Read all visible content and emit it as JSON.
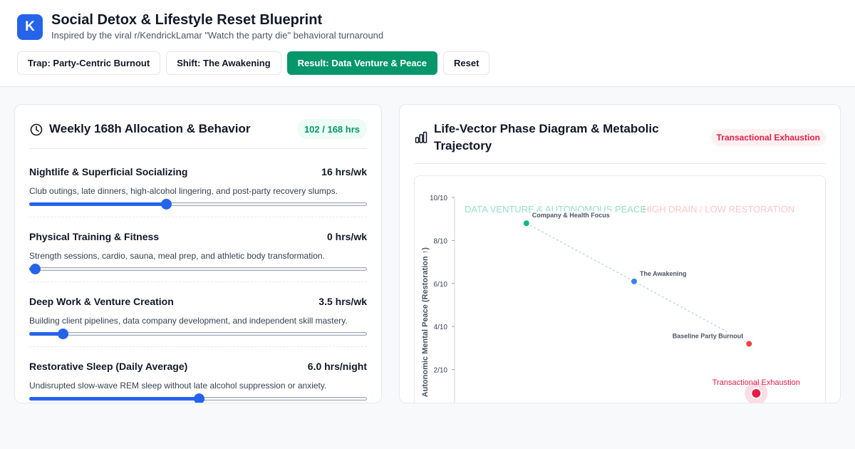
{
  "header": {
    "logo_letter": "K",
    "title": "Social Detox & Lifestyle Reset Blueprint",
    "subtitle": "Inspired by the viral r/KendrickLamar \"Watch the party die\" behavioral turnaround"
  },
  "tabs": [
    {
      "label": "Trap: Party-Centric Burnout",
      "active": false
    },
    {
      "label": "Shift: The Awakening",
      "active": false
    },
    {
      "label": "Result: Data Venture & Peace",
      "active": true
    },
    {
      "label": "Reset",
      "active": false
    }
  ],
  "allocation": {
    "icon": "clock-icon",
    "title": "Weekly 168h Allocation & Behavior",
    "badge": "102 / 168 hrs",
    "items": [
      {
        "name": "Nightlife & Superficial Socializing",
        "value_label": "16 hrs/wk",
        "description": "Club outings, late dinners, high-alcohol lingering, and post-party recovery slumps.",
        "level": 0.4
      },
      {
        "name": "Physical Training & Fitness",
        "value_label": "0 hrs/wk",
        "description": "Strength sessions, cardio, sauna, meal prep, and athletic body transformation.",
        "level": 0.0
      },
      {
        "name": "Deep Work & Venture Creation",
        "value_label": "3.5 hrs/wk",
        "description": "Building client pipelines, data company development, and independent skill mastery.",
        "level": 0.085
      },
      {
        "name": "Restorative Sleep (Daily Average)",
        "value_label": "6.0 hrs/night",
        "description": "Undisrupted slow-wave REM sleep without late alcohol suppression or anxiety.",
        "level": 0.5
      }
    ]
  },
  "phase": {
    "icon": "bar-chart-icon",
    "title": "Life-Vector Phase Diagram & Metabolic Trajectory",
    "status_badge": "Transactional Exhaustion",
    "colors": {
      "good": "#10b981",
      "mid": "#3b82f6",
      "bad": "#ef4444",
      "current": "#e11d48"
    }
  },
  "chart_data": {
    "type": "scatter",
    "ylabel": "Autonomic Mental Peace (Restoration ↑)",
    "yticks": [
      "10/10",
      "8/10",
      "6/10",
      "4/10",
      "2/10"
    ],
    "ylim": [
      0,
      10
    ],
    "xlim": [
      0,
      10
    ],
    "zone_labels": [
      "DATA VENTURE & AUTONOMOUS PEACE",
      "HIGH DRAIN / LOW RESTORATION"
    ],
    "points": [
      {
        "label": "Company & Health Focus",
        "x": 2.0,
        "y": 8.8,
        "color": "#10b981"
      },
      {
        "label": "The Awakening",
        "x": 5.0,
        "y": 6.1,
        "color": "#3b82f6"
      },
      {
        "label": "Baseline Party Burnout",
        "x": 8.2,
        "y": 3.2,
        "color": "#ef4444"
      },
      {
        "label": "Transactional Exhaustion",
        "x": 8.4,
        "y": 0.9,
        "color": "#e11d48"
      }
    ],
    "current_point": "Transactional Exhaustion",
    "grid": false
  }
}
